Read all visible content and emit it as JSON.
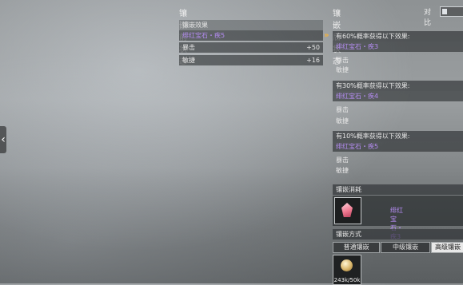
{
  "before": {
    "title": "镶嵌前状态",
    "effect_header": "镶嵌效果",
    "gem": "绯红宝石・疾5",
    "stats": [
      {
        "name": "暴击",
        "value": "+50"
      },
      {
        "name": "敏捷",
        "value": "+16"
      }
    ]
  },
  "after": {
    "title": "镶嵌后状态",
    "compare_label": "对比",
    "outcomes": [
      {
        "header": "有60%概率获得以下效果:",
        "gem": "绯红宝石・疾3",
        "stats": [
          "暴击",
          "敏捷"
        ]
      },
      {
        "header": "有30%概率获得以下效果:",
        "gem": "绯红宝石・疾4",
        "stats": [
          "暴击",
          "敏捷"
        ]
      },
      {
        "header": "有10%概率获得以下效果:",
        "gem": "绯红宝石・疾5",
        "stats": [
          "暴击",
          "敏捷"
        ]
      }
    ]
  },
  "cost": {
    "title": "镶嵌消耗",
    "gem_name": "绯红宝石・疾3"
  },
  "mode": {
    "title": "镶嵌方式",
    "tabs": [
      "普通镶嵌",
      "中级镶嵌",
      "高级镶嵌"
    ],
    "active_tab": 2,
    "item_count": "243k/50k"
  },
  "icons": {
    "nav": "chevron-left-icon",
    "arrow": "double-chevron-right-icon",
    "gem": "gem-icon",
    "currency": "coin-icon"
  },
  "colors": {
    "gem_text": "#b58cf3",
    "arrow": "#f2b13c"
  }
}
